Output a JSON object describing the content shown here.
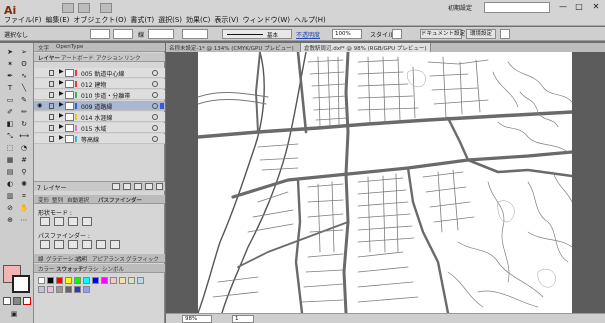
{
  "app": {
    "logo": "Ai"
  },
  "menubar": {
    "items": [
      "ファイル(F)",
      "編集(E)",
      "オブジェクト(O)",
      "書式(T)",
      "選択(S)",
      "効果(C)",
      "表示(V)",
      "ウィンドウ(W)",
      "ヘルプ(H)"
    ],
    "workspace": "初期設定",
    "window_controls": [
      "—",
      "□",
      "✕"
    ]
  },
  "controlbar": {
    "selection": "選択なし",
    "stroke_label": "線",
    "brush": "基本",
    "opacity_label": "不透明度",
    "opacity": "100%",
    "style_label": "スタイル",
    "doc_settings": "ドキュメント設定",
    "preferences": "環境設定"
  },
  "layers_panel": {
    "tabs": [
      "文字",
      "OpenType"
    ],
    "subtabs": [
      "レイヤー",
      "アートボード",
      "アクション",
      "リンク"
    ],
    "layers": [
      {
        "name": "005 軌道中心線",
        "color": "#e23c3c"
      },
      {
        "name": "012 建物",
        "color": "#e23c3c"
      },
      {
        "name": "010 歩道・分離帯",
        "color": "#3cb24a"
      },
      {
        "name": "009 道路縁",
        "color": "#3a5ec9"
      },
      {
        "name": "014 水涯線",
        "color": "#e3c53a"
      },
      {
        "name": "015 水域",
        "color": "#d97ad9"
      },
      {
        "name": "等高線",
        "color": "#3ab5c9"
      }
    ],
    "count_label": "7 レイヤー"
  },
  "pathfinder_panel": {
    "tabs": [
      "変形",
      "整列",
      "自動選択",
      "パスファインダー"
    ],
    "shape_modes_label": "形状モード :",
    "pathfinders_label": "パスファインダー :"
  },
  "swatch_panel": {
    "tabs": [
      "線",
      "グラデーション",
      "透明",
      "アピアランス",
      "グラフィック"
    ],
    "subtabs": [
      "カラー",
      "スウォッチ",
      "ブラシ",
      "シンボル"
    ],
    "swatches": [
      "#ffffff",
      "#000000",
      "#ff0000",
      "#ffff00",
      "#00ff00",
      "#00ffff",
      "#0000ff",
      "#ff00ff",
      "#f7c6c6",
      "#f5e0b0",
      "#d2e8b8",
      "#b8d8e8",
      "#c8c0e0",
      "#e8c0d8",
      "#999999",
      "#666666",
      "#3333cc",
      "#9999ff"
    ]
  },
  "document": {
    "tabs": [
      "名称未設定-1* @ 134% (CMYK/GPU プレビュー)",
      "倉敷駅周辺.dxf* @ 98% (RGB/GPU プレビュー)"
    ],
    "zoom": "98%",
    "page": "1"
  },
  "colors": {
    "accent": "#3a5ec9",
    "fill": "#f5b4b4"
  }
}
